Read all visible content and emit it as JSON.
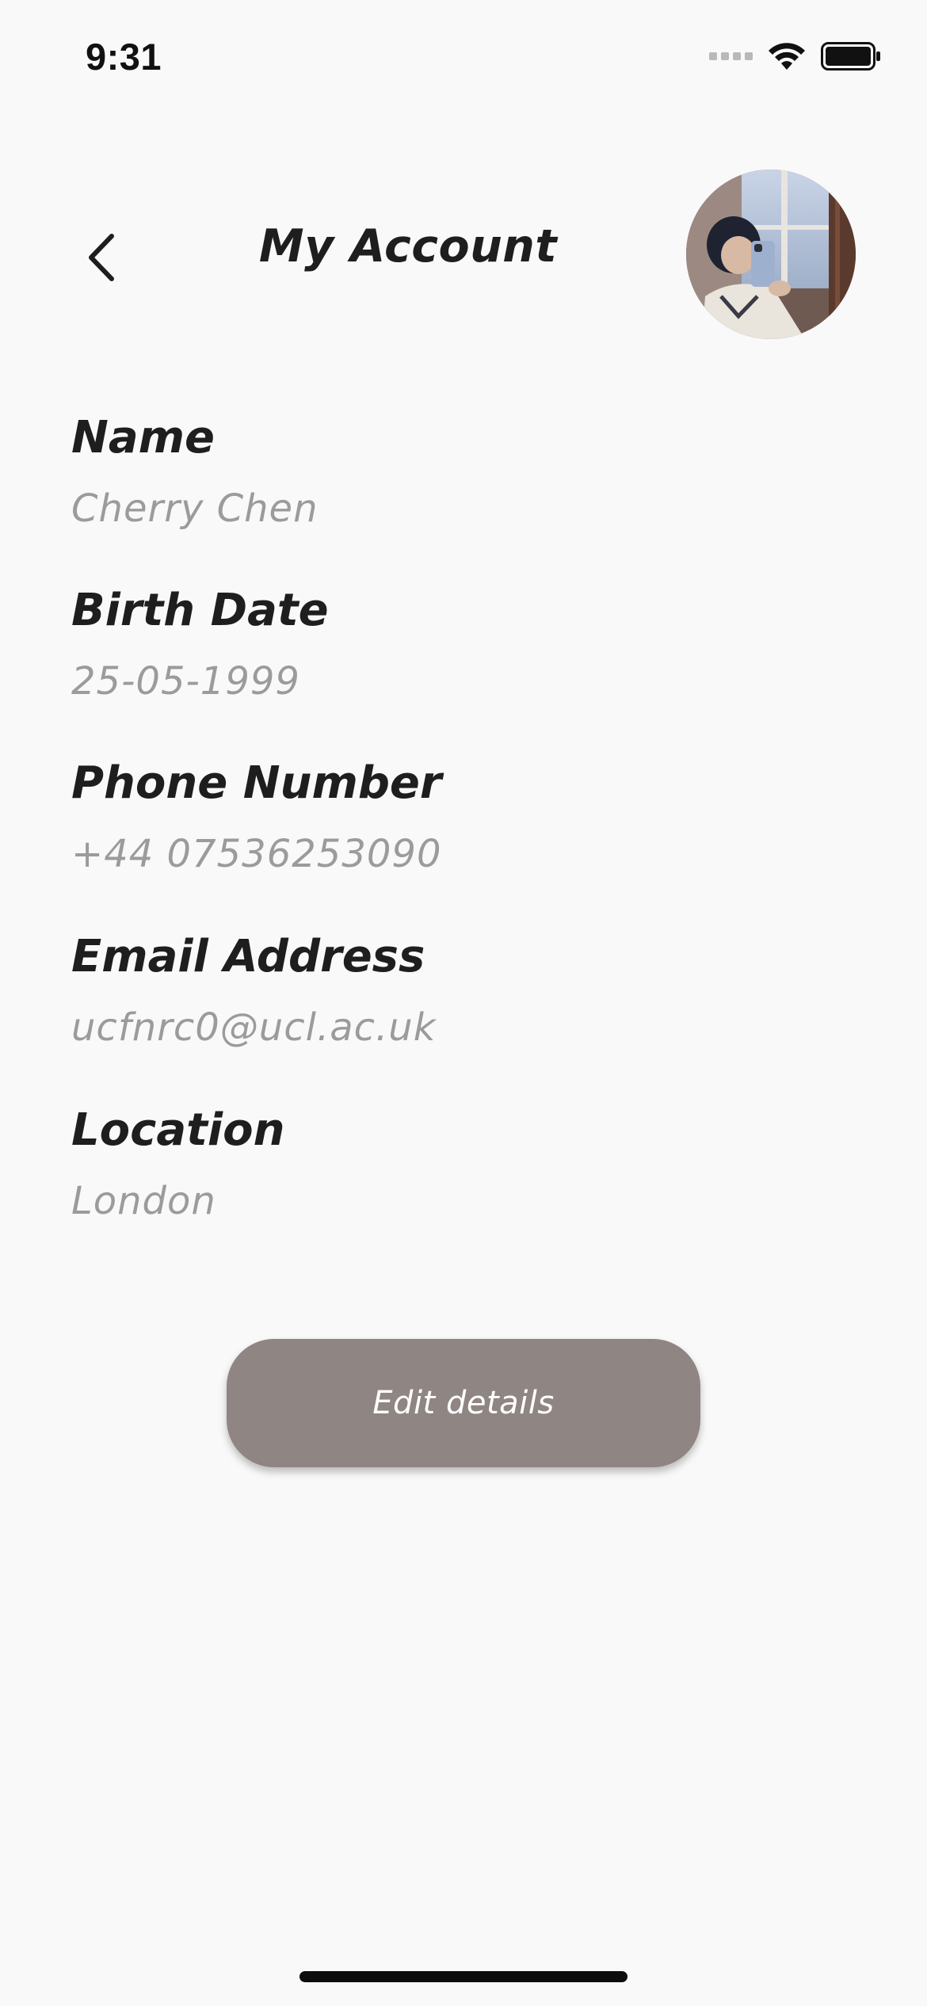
{
  "status_bar": {
    "time": "9:31"
  },
  "header": {
    "title": "My Account",
    "back_icon": "chevron-left-icon",
    "avatar_alt": "profile photo"
  },
  "fields": [
    {
      "label": "Name",
      "value": "Cherry Chen"
    },
    {
      "label": "Birth Date",
      "value": "25-05-1999"
    },
    {
      "label": "Phone Number",
      "value": "+44 07536253090"
    },
    {
      "label": "Email Address",
      "value": "ucfnrc0@ucl.ac.uk"
    },
    {
      "label": "Location",
      "value": "London"
    }
  ],
  "actions": {
    "edit_label": "Edit details"
  },
  "colors": {
    "background": "#f9f9f9",
    "label_text": "#1e1e1e",
    "value_text": "#9b9b9b",
    "button_fill": "#8f8583",
    "button_text": "#ffffff"
  }
}
